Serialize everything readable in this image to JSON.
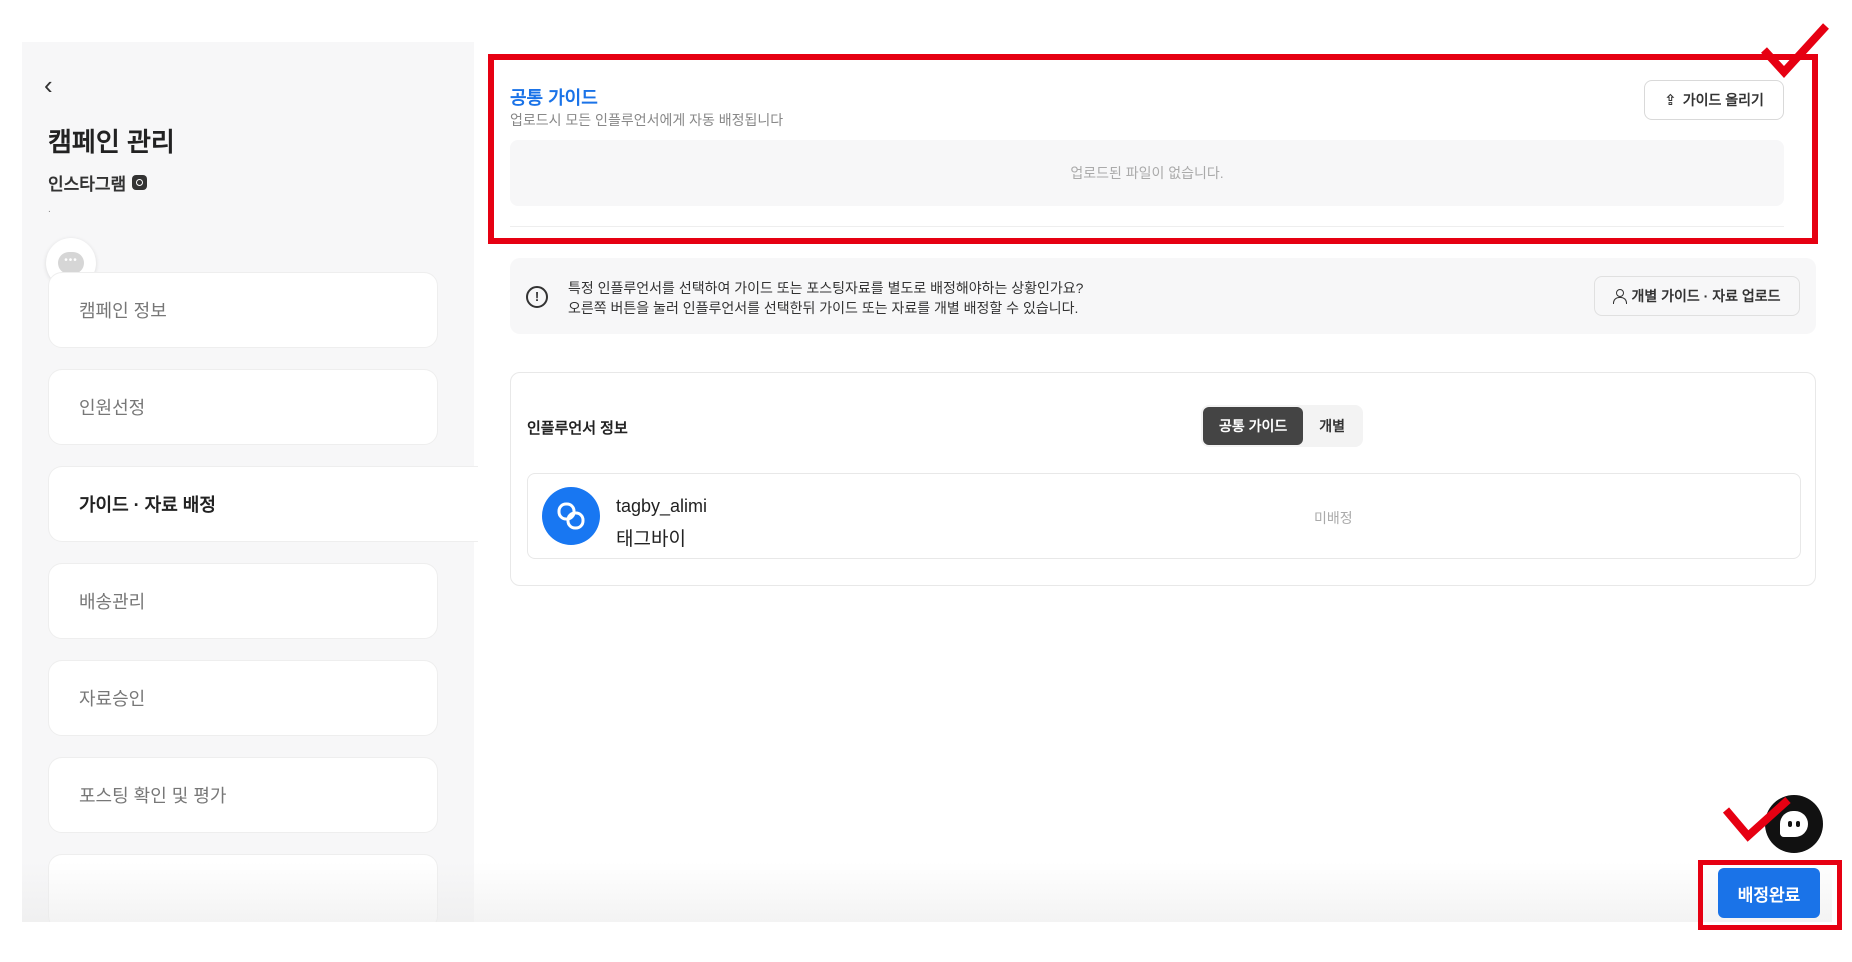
{
  "sidebar": {
    "back_icon": "chevron-left-icon",
    "title": "캠페인 관리",
    "platform": "인스타그램",
    "platform_icon": "instagram-icon",
    "dot": ".",
    "chat_icon": "chat-bubble-icon",
    "items": [
      {
        "label": "캠페인 정보",
        "active": false
      },
      {
        "label": "인원선정",
        "active": false
      },
      {
        "label": "가이드 · 자료 배정",
        "active": true
      },
      {
        "label": "배송관리",
        "active": false
      },
      {
        "label": "자료승인",
        "active": false
      },
      {
        "label": "포스팅 확인 및 평가",
        "active": false
      }
    ]
  },
  "guide": {
    "title": "공통 가이드",
    "description": "업로드시 모든 인플루언서에게 자동 배정됩니다",
    "upload_button": "가이드 올리기",
    "upload_icon": "upload-icon",
    "empty_text": "업로드된 파일이 없습니다."
  },
  "banner": {
    "icon": "alert-circle-icon",
    "line1": "특정 인플루언서를 선택하여 가이드 또는 포스팅자료를 별도로 배정해야하는 상황인가요?",
    "line2": "오른쪽 버튼을 눌러 인플루언서를 선택한뒤 가이드 또는 자료를 개별 배정할 수 있습니다.",
    "button": "개별 가이드 · 자료 업로드",
    "button_icon": "person-icon"
  },
  "influencer_panel": {
    "title": "인플루언서 정보",
    "toggle": {
      "options": [
        "공통 가이드",
        "개별"
      ],
      "selected": "공통 가이드"
    },
    "rows": [
      {
        "handle": "tagby_alimi",
        "name": "태그바이",
        "status": "미배정",
        "avatar_color": "#1877f2"
      }
    ]
  },
  "footer": {
    "confirm_button": "배정완료",
    "cs_icon": "support-chat-icon"
  },
  "colors": {
    "accent": "#1a73e8",
    "highlight": "#e60012"
  }
}
